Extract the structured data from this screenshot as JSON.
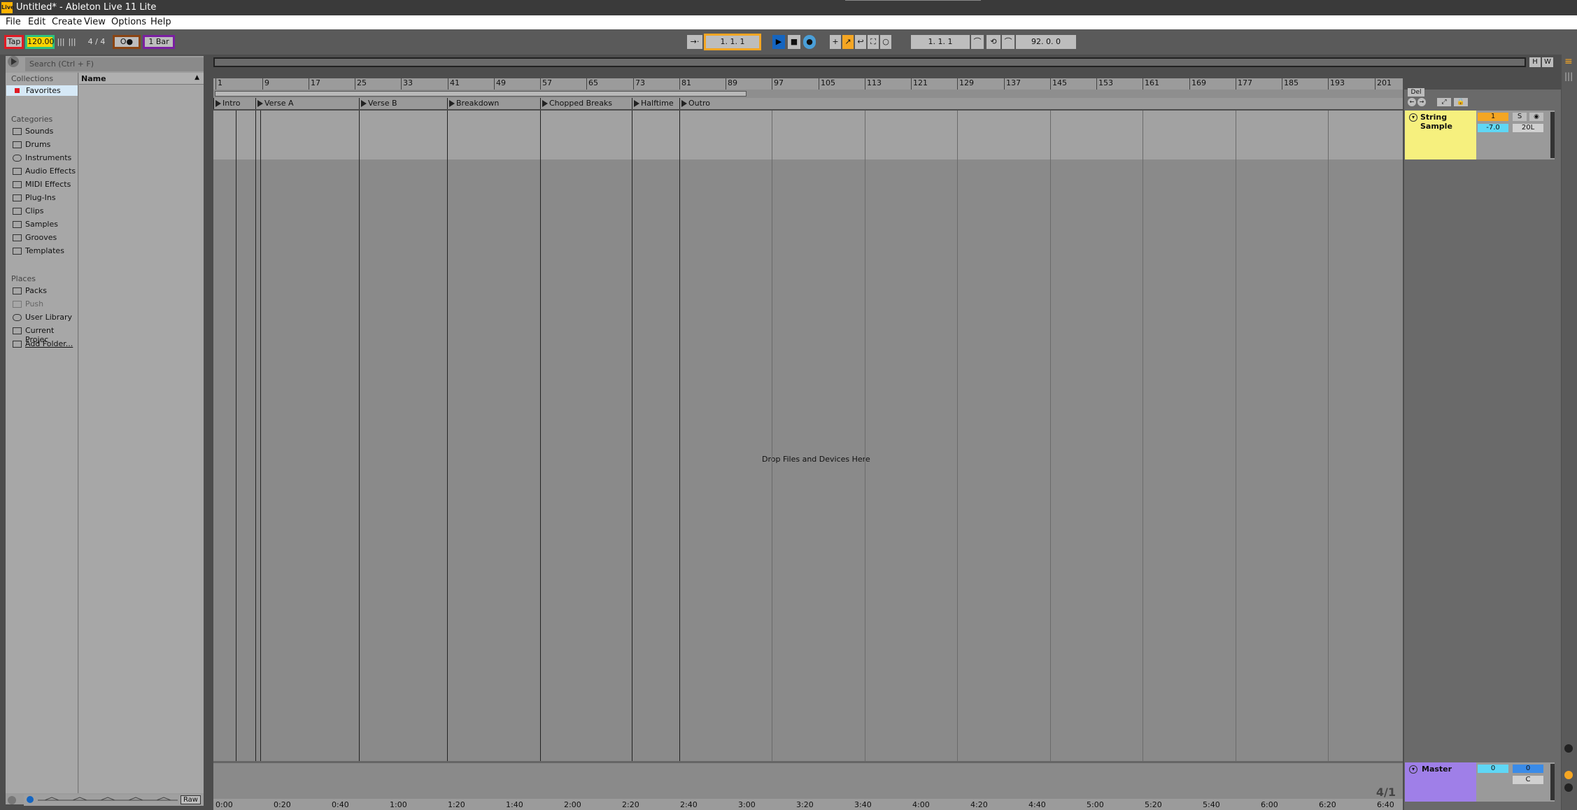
{
  "window": {
    "title": "Untitled* - Ableton Live 11 Lite",
    "app_icon_text": "Live"
  },
  "menu": [
    "File",
    "Edit",
    "Create",
    "View",
    "Options",
    "Help"
  ],
  "control_bar": {
    "tap_label": "Tap",
    "tempo": "120.00",
    "time_signature": "4 / 4",
    "metronome_label": "O●",
    "quantize": "1 Bar",
    "arrangement_position": "1.   1.   1",
    "loop_start": "1.   1.   1",
    "loop_length": "92.   0.   0",
    "colors": {
      "tap_outline": "#e01b24",
      "tempo_outline": "#2ec27e",
      "metronome_outline": "#8b4513",
      "quantize_outline": "#7b1fa2",
      "position_outline": "#f5a623",
      "play_active": "#1565c0"
    }
  },
  "browser": {
    "search_placeholder": "Search (Ctrl + F)",
    "collections_header": "Collections",
    "favorites": "Favorites",
    "categories_header": "Categories",
    "categories": [
      "Sounds",
      "Drums",
      "Instruments",
      "Audio Effects",
      "MIDI Effects",
      "Plug-Ins",
      "Clips",
      "Samples",
      "Grooves",
      "Templates"
    ],
    "places_header": "Places",
    "places": [
      "Packs",
      "Push",
      "User Library",
      "Current Projec",
      "Add Folder..."
    ],
    "name_column": "Name",
    "raw_label": "Raw"
  },
  "arrangement": {
    "bar_ruler": [
      "1",
      "9",
      "17",
      "25",
      "33",
      "41",
      "49",
      "57",
      "65",
      "73",
      "81",
      "89",
      "97",
      "105",
      "113",
      "121",
      "129",
      "137",
      "145",
      "153",
      "161",
      "169",
      "177",
      "185",
      "193",
      "201"
    ],
    "locators": [
      "Intro",
      "Verse A",
      "Verse B",
      "Breakdown",
      "Chopped Breaks",
      "Halftime",
      "Outro"
    ],
    "drop_hint": "Drop Files and Devices Here",
    "time_ruler": [
      "0:00",
      "0:20",
      "0:40",
      "1:00",
      "1:20",
      "1:40",
      "2:00",
      "2:20",
      "2:40",
      "3:00",
      "3:20",
      "3:40",
      "4:00",
      "4:20",
      "4:40",
      "5:00",
      "5:20",
      "5:40",
      "6:00",
      "6:20",
      "6:40"
    ],
    "zoom_label": "4/1",
    "overview_buttons": [
      "H",
      "W"
    ],
    "del_label": "Del"
  },
  "track": {
    "name": "String Sample",
    "number": "1",
    "solo": "S",
    "volume": "-7.0",
    "pan": "20L",
    "color": "#f6f07e"
  },
  "master": {
    "name": "Master",
    "volume": "0",
    "pan": "0",
    "cue": "C",
    "color": "#9f7fe8"
  }
}
